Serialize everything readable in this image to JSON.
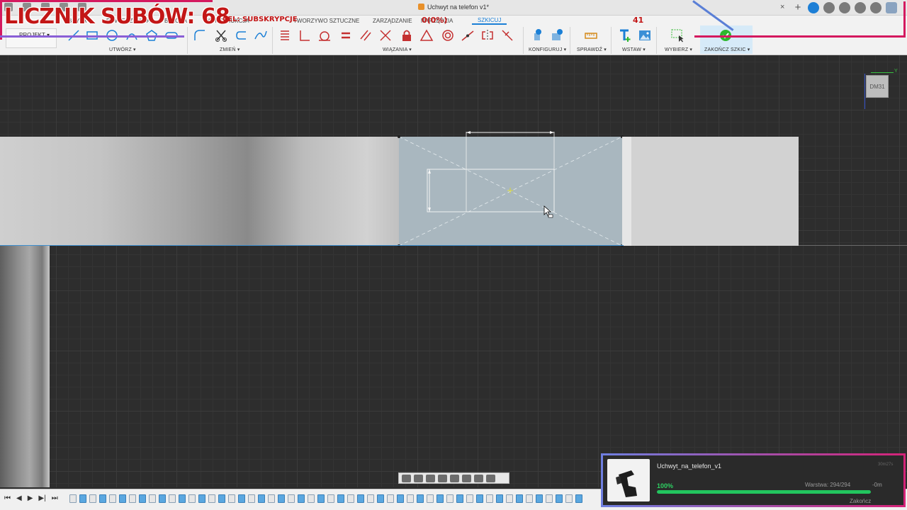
{
  "window": {
    "title": "Uchwyt na telefon v1*",
    "close_label": "×"
  },
  "ribbon": {
    "workspace_label": "PROJEKT",
    "tabs": [
      {
        "label": "BRYŁA"
      },
      {
        "label": "POWIERZCHNIA"
      },
      {
        "label": "BLACHA"
      },
      {
        "label": "KONSTRUKCJA"
      },
      {
        "label": "TWORZYWO SZTUCZNE"
      },
      {
        "label": "ZARZĄDZANIE"
      },
      {
        "label": "NARZĘDZIA"
      },
      {
        "label": "SZKICUJ"
      }
    ],
    "groups": {
      "create": "UTWÓRZ ▾",
      "modify": "ZMIEŃ ▾",
      "constraints": "WIĄZANIA ▾",
      "configure": "KONFIGURUJ ▾",
      "inspect": "SPRAWDŹ ▾",
      "insert": "WSTAW ▾",
      "select": "WYBIERZ ▾",
      "finish": "ZAKOŃCZ SZKIC ▾"
    }
  },
  "viewcube": {
    "face": "DM31",
    "axis_label": "Y"
  },
  "overlay": {
    "sub_counter": "LICZNIK SUBÓW: 68",
    "goal_label": "CEL: SUBSKRYPCJE",
    "goal_progress": "0(0%)",
    "goal_target": "41"
  },
  "timeline": {
    "controls": [
      "⏮",
      "◀",
      "▶",
      "▶|",
      "⏭"
    ]
  },
  "print_job": {
    "name": "Uchwyt_na_telefon_v1",
    "elapsed": "30m27s",
    "percent_label": "100%",
    "percent": 100,
    "layer": "Warstwa: 294/294",
    "remaining": "-0m",
    "status": "Zakończ"
  },
  "colors": {
    "accent": "#1a7fd6",
    "overlay_red": "#c31616",
    "overlay_pink": "#d4195f",
    "progress_green": "#22c55e"
  }
}
